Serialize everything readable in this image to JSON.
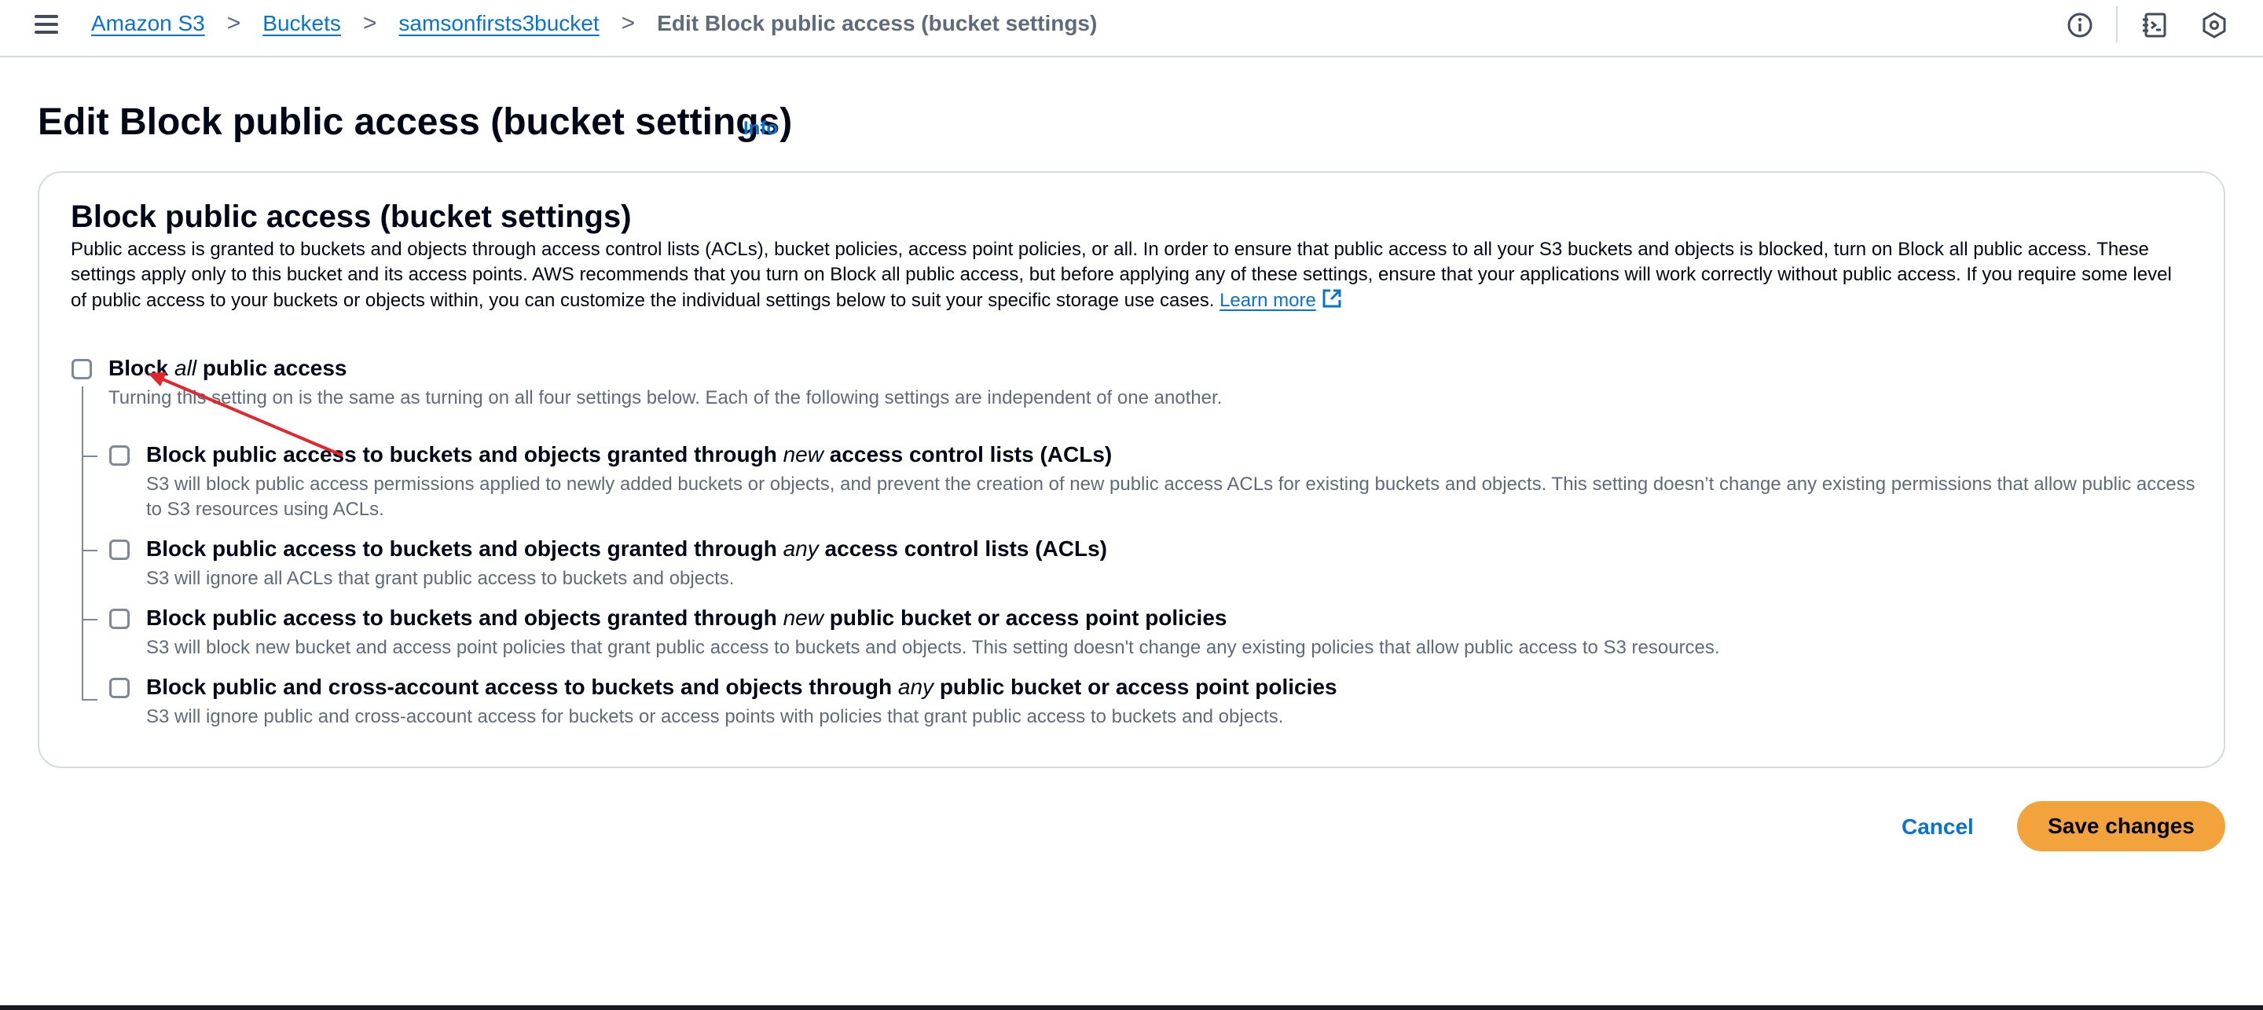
{
  "breadcrumb": {
    "items": [
      "Amazon S3",
      "Buckets",
      "samsonfirsts3bucket"
    ],
    "current": "Edit Block public access (bucket settings)",
    "separator": ">"
  },
  "header": {
    "title": "Edit Block public access (bucket settings)",
    "info_label": "Info"
  },
  "panel": {
    "title": "Block public access (bucket settings)",
    "description": "Public access is granted to buckets and objects through access control lists (ACLs), bucket policies, access point policies, or all. In order to ensure that public access to all your S3 buckets and objects is blocked, turn on Block all public access. These settings apply only to this bucket and its access points. AWS recommends that you turn on Block all public access, but before applying any of these settings, ensure that your applications will work correctly without public access. If you require some level of public access to your buckets or objects within, you can customize the individual settings below to suit your specific storage use cases.",
    "learn_more": "Learn more"
  },
  "options": {
    "all": {
      "label_pre": "Block ",
      "label_em": "all",
      "label_post": " public access",
      "desc": "Turning this setting on is the same as turning on all four settings below. Each of the following settings are independent of one another.",
      "checked": false
    },
    "items": [
      {
        "label_pre": "Block public access to buckets and objects granted through ",
        "label_em": "new",
        "label_post": " access control lists (ACLs)",
        "desc": "S3 will block public access permissions applied to newly added buckets or objects, and prevent the creation of new public access ACLs for existing buckets and objects. This setting doesn’t change any existing permissions that allow public access to S3 resources using ACLs.",
        "checked": false
      },
      {
        "label_pre": "Block public access to buckets and objects granted through ",
        "label_em": "any",
        "label_post": " access control lists (ACLs)",
        "desc": "S3 will ignore all ACLs that grant public access to buckets and objects.",
        "checked": false
      },
      {
        "label_pre": "Block public access to buckets and objects granted through ",
        "label_em": "new",
        "label_post": " public bucket or access point policies",
        "desc": "S3 will block new bucket and access point policies that grant public access to buckets and objects. This setting doesn't change any existing policies that allow public access to S3 resources.",
        "checked": false
      },
      {
        "label_pre": "Block public and cross-account access to buckets and objects through ",
        "label_em": "any",
        "label_post": " public bucket or access point policies",
        "desc": "S3 will ignore public and cross-account access for buckets or access points with policies that grant public access to buckets and objects.",
        "checked": false
      }
    ]
  },
  "footer": {
    "cancel_label": "Cancel",
    "save_label": "Save changes"
  },
  "colors": {
    "link": "#0972d3",
    "primary_button": "#f3a33c",
    "annotation_arrow": "#e3262b"
  },
  "icons": [
    "menu-icon",
    "info-circle-icon",
    "notes-icon",
    "settings-hex-icon",
    "external-link-icon"
  ]
}
